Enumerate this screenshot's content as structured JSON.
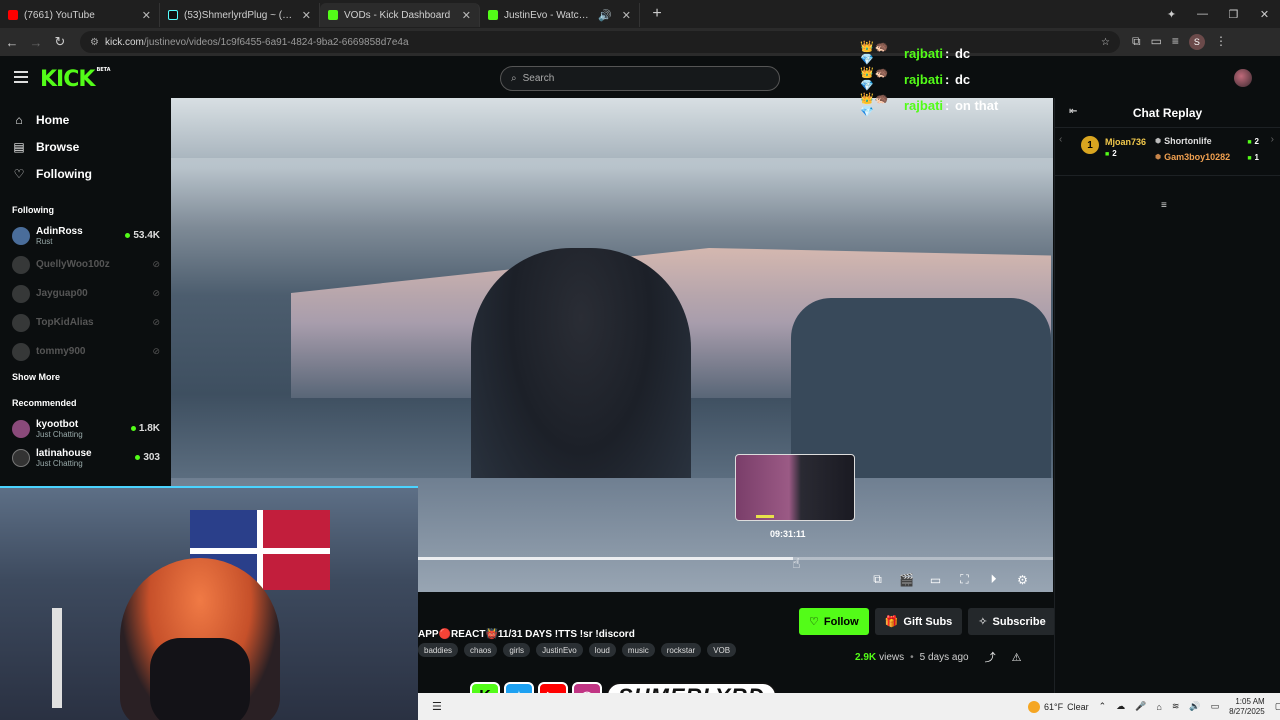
{
  "browser": {
    "tabs": [
      {
        "title": "(7661) YouTube",
        "color": "#ff0000",
        "active": false
      },
      {
        "title": "(53)ShmerlyrdPlug ~ (@shmerl",
        "color": "#111111",
        "active": false
      },
      {
        "title": "VODs - Kick Dashboard",
        "color": "#53fc18",
        "active": true
      },
      {
        "title": "JustinEvo - Watch the VOD",
        "color": "#53fc18",
        "active": false
      }
    ],
    "url_host": "kick.com",
    "url_path": "/justinevo/videos/1c9f6455-6a91-4824-9ba2-6669858d7e4a",
    "profile_initial": "S"
  },
  "kick": {
    "logo_text": "KICK",
    "logo_tag": "BETA",
    "search_placeholder": "Search",
    "nav": [
      {
        "label": "Home",
        "icon": "home-icon",
        "glyph": "⌂"
      },
      {
        "label": "Browse",
        "icon": "browse-icon",
        "glyph": "▤"
      },
      {
        "label": "Following",
        "icon": "heart-icon",
        "glyph": "♡"
      }
    ],
    "following_title": "Following",
    "following": [
      {
        "name": "AdinRoss",
        "category": "Rust",
        "viewers": "53.4K",
        "live": true,
        "color": "#4a6d9a"
      },
      {
        "name": "QuellyWoo100z",
        "category": "",
        "viewers": "",
        "live": false,
        "color": "#888"
      },
      {
        "name": "Jayguap00",
        "category": "",
        "viewers": "",
        "live": false,
        "color": "#888"
      },
      {
        "name": "TopKidAlias",
        "category": "",
        "viewers": "",
        "live": false,
        "color": "#888"
      },
      {
        "name": "tommy900",
        "category": "",
        "viewers": "",
        "live": false,
        "color": "#888"
      }
    ],
    "show_more": "Show More",
    "recommended_title": "Recommended",
    "recommended": [
      {
        "name": "kyootbot",
        "category": "Just Chatting",
        "viewers": "1.8K",
        "live": true,
        "color": "#8a4a7a"
      },
      {
        "name": "latinahouse",
        "category": "Just Chatting",
        "viewers": "303",
        "live": true,
        "color": "#333"
      }
    ]
  },
  "overlay_chat": [
    {
      "emotes": "👑🦔💎",
      "user": "rajbati",
      "msg": "dc"
    },
    {
      "emotes": "👑🦔💎",
      "user": "rajbati",
      "msg": "dc"
    },
    {
      "emotes": "👑🦔💎",
      "user": "rajbati",
      "msg": "on that"
    }
  ],
  "player": {
    "timecode": "09:31:11",
    "progress": 0.59
  },
  "video": {
    "title": "APP🔴REACT👹11/31 DAYS !TTS !sr !discord",
    "tags": [
      "baddies",
      "chaos",
      "girls",
      "JustinEvo",
      "loud",
      "music",
      "rockstar",
      "VOB"
    ],
    "views": "2.9K",
    "views_label": "views",
    "age": "5 days ago",
    "follow_label": "Follow",
    "gift_label": "Gift Subs",
    "subscribe_label": "Subscribe"
  },
  "chat_replay": {
    "title": "Chat Replay",
    "top": {
      "rank": "1",
      "name": "Mjoan736",
      "count": "2"
    },
    "others": [
      {
        "name": "Shortonlife",
        "count": "2",
        "color": "#dddddd"
      },
      {
        "name": "Gam3boy10282",
        "count": "1",
        "color": "#f0a050"
      }
    ]
  },
  "banner": {
    "name": "SHMERLYRD"
  },
  "taskbar": {
    "weather": "61°F",
    "weather_desc": "Clear",
    "time": "1:05 AM",
    "date": "8/27/2025"
  }
}
